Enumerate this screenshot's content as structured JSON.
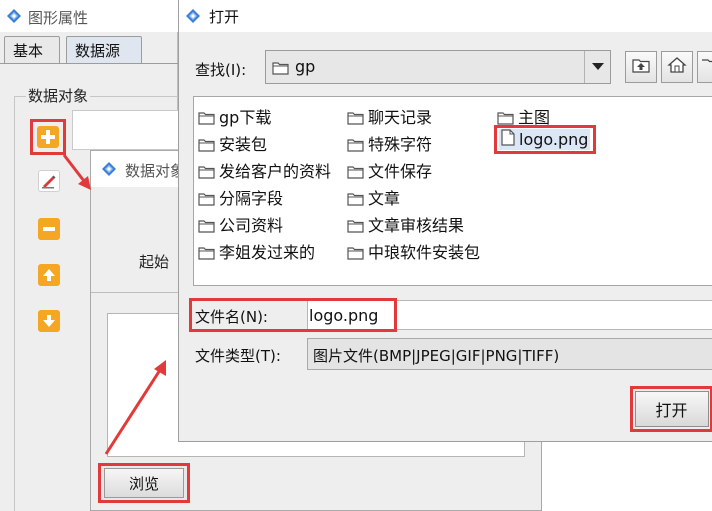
{
  "background_window": {
    "title": "图形属性",
    "tabs": [
      {
        "label": "基本",
        "active": false
      },
      {
        "label": "数据源",
        "active": true
      }
    ],
    "group_label": "数据对象",
    "toolbar": [
      {
        "name": "add",
        "icon": "plus-icon",
        "highlighted": true
      },
      {
        "name": "edit",
        "icon": "edit-icon",
        "highlighted": false
      },
      {
        "name": "remove",
        "icon": "minus-icon",
        "highlighted": false
      },
      {
        "name": "move-up",
        "icon": "arrow-up-icon",
        "highlighted": false
      },
      {
        "name": "move-down",
        "icon": "arrow-down-icon",
        "highlighted": false
      }
    ]
  },
  "middle_dialog": {
    "title": "数据对象",
    "start_label": "起始",
    "browse_label": "浏览"
  },
  "open_dialog": {
    "title": "打开",
    "look_in_label": "查找(I):",
    "look_in_mnemonic": "I",
    "look_in_value": "gp",
    "files": [
      {
        "name": "gp下载",
        "type": "folder",
        "selected": false
      },
      {
        "name": "安装包",
        "type": "folder",
        "selected": false
      },
      {
        "name": "发给客户的资料",
        "type": "folder",
        "selected": false
      },
      {
        "name": "分隔字段",
        "type": "folder",
        "selected": false
      },
      {
        "name": "公司资料",
        "type": "folder",
        "selected": false
      },
      {
        "name": "李姐发过来的",
        "type": "folder",
        "selected": false
      },
      {
        "name": "聊天记录",
        "type": "folder",
        "selected": false
      },
      {
        "name": "特殊字符",
        "type": "folder",
        "selected": false
      },
      {
        "name": "文件保存",
        "type": "folder",
        "selected": false
      },
      {
        "name": "文章",
        "type": "folder",
        "selected": false
      },
      {
        "name": "文章审核结果",
        "type": "folder",
        "selected": false
      },
      {
        "name": "中琅软件安装包",
        "type": "folder",
        "selected": false
      },
      {
        "name": "主图",
        "type": "folder",
        "selected": false
      },
      {
        "name": "logo.png",
        "type": "file",
        "selected": true
      }
    ],
    "file_name_label": "文件名(N):",
    "file_name_value": "logo.png",
    "file_type_label": "文件类型(T):",
    "file_type_value": "图片文件(BMP|JPEG|GIF|PNG|TIFF)",
    "open_button": "打开"
  },
  "colors": {
    "highlight_red": "#e23a3a",
    "icon_orange": "#f5a623",
    "app_icon_blue": "#3d7fd6"
  }
}
